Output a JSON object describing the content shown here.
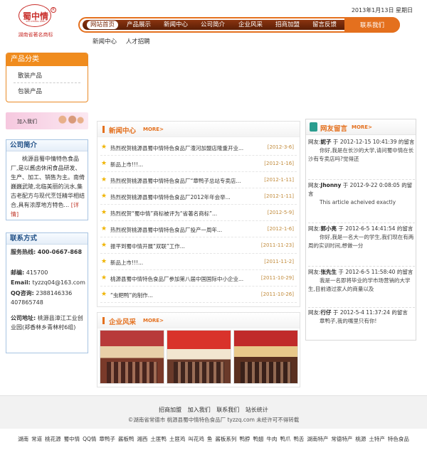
{
  "header": {
    "brand": "蜀中情",
    "brand_en": "SHU ZHONG QING",
    "reg_mark": "R",
    "slogan": "湖南省著名商标",
    "date": "2013年1月13日 星期日"
  },
  "nav": {
    "items": [
      "网站首页",
      "产品展示",
      "新闻中心",
      "公司简介",
      "企业风采",
      "招商加盟",
      "留言反馈"
    ],
    "contact": "联系我们"
  },
  "subnav": [
    "新闻中心",
    "人才招聘"
  ],
  "category": {
    "title": "产品分类",
    "items": [
      "散装产品",
      "包装产品"
    ]
  },
  "join": {
    "label": "加入我们"
  },
  "intro": {
    "title": "公司简介",
    "text": "桃源县蜀中情特色食品厂,是以酱卤休闲食品研发、生产、加工、销售为主。南倚巍巍武陵,北临美丽的沅水,集古老配方与现代烹饪精华相结合,具有浓厚地方特色...",
    "more": "[详情]"
  },
  "contact": {
    "title": "联系方式",
    "hotline_label": "服务热线:",
    "hotline": "400-0667-868",
    "email_label": "邮编:",
    "zip": "415700",
    "mail_label": "Email:",
    "mail": "tyzzq04@163.com",
    "qq_label": "QQ咨询:",
    "qq": "2388146336 407865748",
    "addr_label": "公司地址:",
    "addr": "桃源县漳江工业创业园(郑香林乡青林村6组)"
  },
  "news": {
    "title": "新闻中心",
    "more": "MORE>",
    "items": [
      {
        "title": "热烈祝贺桃源县蜀中情特色食品厂澧河加盟店隆重开业...",
        "date": "[2012-3-6]"
      },
      {
        "title": "新品上市!!!...",
        "date": "[2012-1-16]"
      },
      {
        "title": "热烈祝贺桃源县蜀中情特色食品厂“章鸭子总站专卖店...",
        "date": "[2012-1-11]"
      },
      {
        "title": "热烈祝贺桃源县蜀中情特色食品厂2012年年会举...",
        "date": "[2012-1-11]"
      },
      {
        "title": "热烈祝贺“蜀中情”商标被评为“省著名商标”...",
        "date": "[2012-5-9]"
      },
      {
        "title": "热烈祝贺桃源县蜀中情特色食品厂投产一周年...",
        "date": "[2012-1-6]"
      },
      {
        "title": "振平到蜀中情开展“双联”工作...",
        "date": "[2011-11-23]"
      },
      {
        "title": "新品上市!!!...",
        "date": "[2011-11-2]"
      },
      {
        "title": "桃源县蜀中情特色食品厂参加第八届中国国际中小企业...",
        "date": "[2011-10-29]"
      },
      {
        "title": "“虫粑鸭”的制作...",
        "date": "[2011-10-26]"
      }
    ]
  },
  "style": {
    "title": "企业风采",
    "more": "MORE>"
  },
  "messages": {
    "title": "网友留言",
    "more": "MORE>",
    "items": [
      {
        "prefix": "网友:",
        "name": "妮子",
        "at": "于",
        "time": "2012-12-15 10:41:39",
        "suffix": "的留言",
        "content": "你好,我是在长沙的大学,请问蜀中情在长沙有专卖店吗?觉得还"
      },
      {
        "prefix": "网友:",
        "name": "Jhonny",
        "at": "于",
        "time": "2012-9-22 0:08:05",
        "suffix": "的留言",
        "content": "This article acheived exactly"
      },
      {
        "prefix": "网友:",
        "name": "郭小亮",
        "at": "于",
        "time": "2012-6-5 14:41:54",
        "suffix": "的留言",
        "content": "你好,我是一名大一的学生,我们现在有两周的实训时间,想做一分"
      },
      {
        "prefix": "网友:",
        "name": "张先生",
        "at": "于",
        "time": "2012-6-5 11:58:40",
        "suffix": "的留言",
        "content": "我是一名即将毕业的学市场营销的大学生,目前通过家人的商量以及"
      },
      {
        "prefix": "网友:",
        "name": "行仔",
        "at": "于",
        "time": "2012-5-4 11:37:24",
        "suffix": "的留言",
        "content": "章鸭子,我的嘴里只有你!"
      }
    ]
  },
  "footer": {
    "links": [
      "招商加盟",
      "加入我们",
      "联系我们",
      "站长统计"
    ],
    "copyright": "©湖南省常德市 桃源县蜀中情特色食品厂 tyzzq.com 未经许可不得转载",
    "tags": [
      "湖南",
      "常道",
      "桃花源",
      "蜀中情",
      "QQ情",
      "章鸭子",
      "酱板鸭",
      "湘西",
      "土匪鸭",
      "土匪鸡",
      "叫花鸡",
      "鱼",
      "酱板系列",
      "鸭脖",
      "鸭翅",
      "牛肉",
      "鸭爪",
      "鸭舌",
      "湖南特产",
      "常德特产",
      "桃源",
      "土特产",
      "特色食品"
    ]
  }
}
